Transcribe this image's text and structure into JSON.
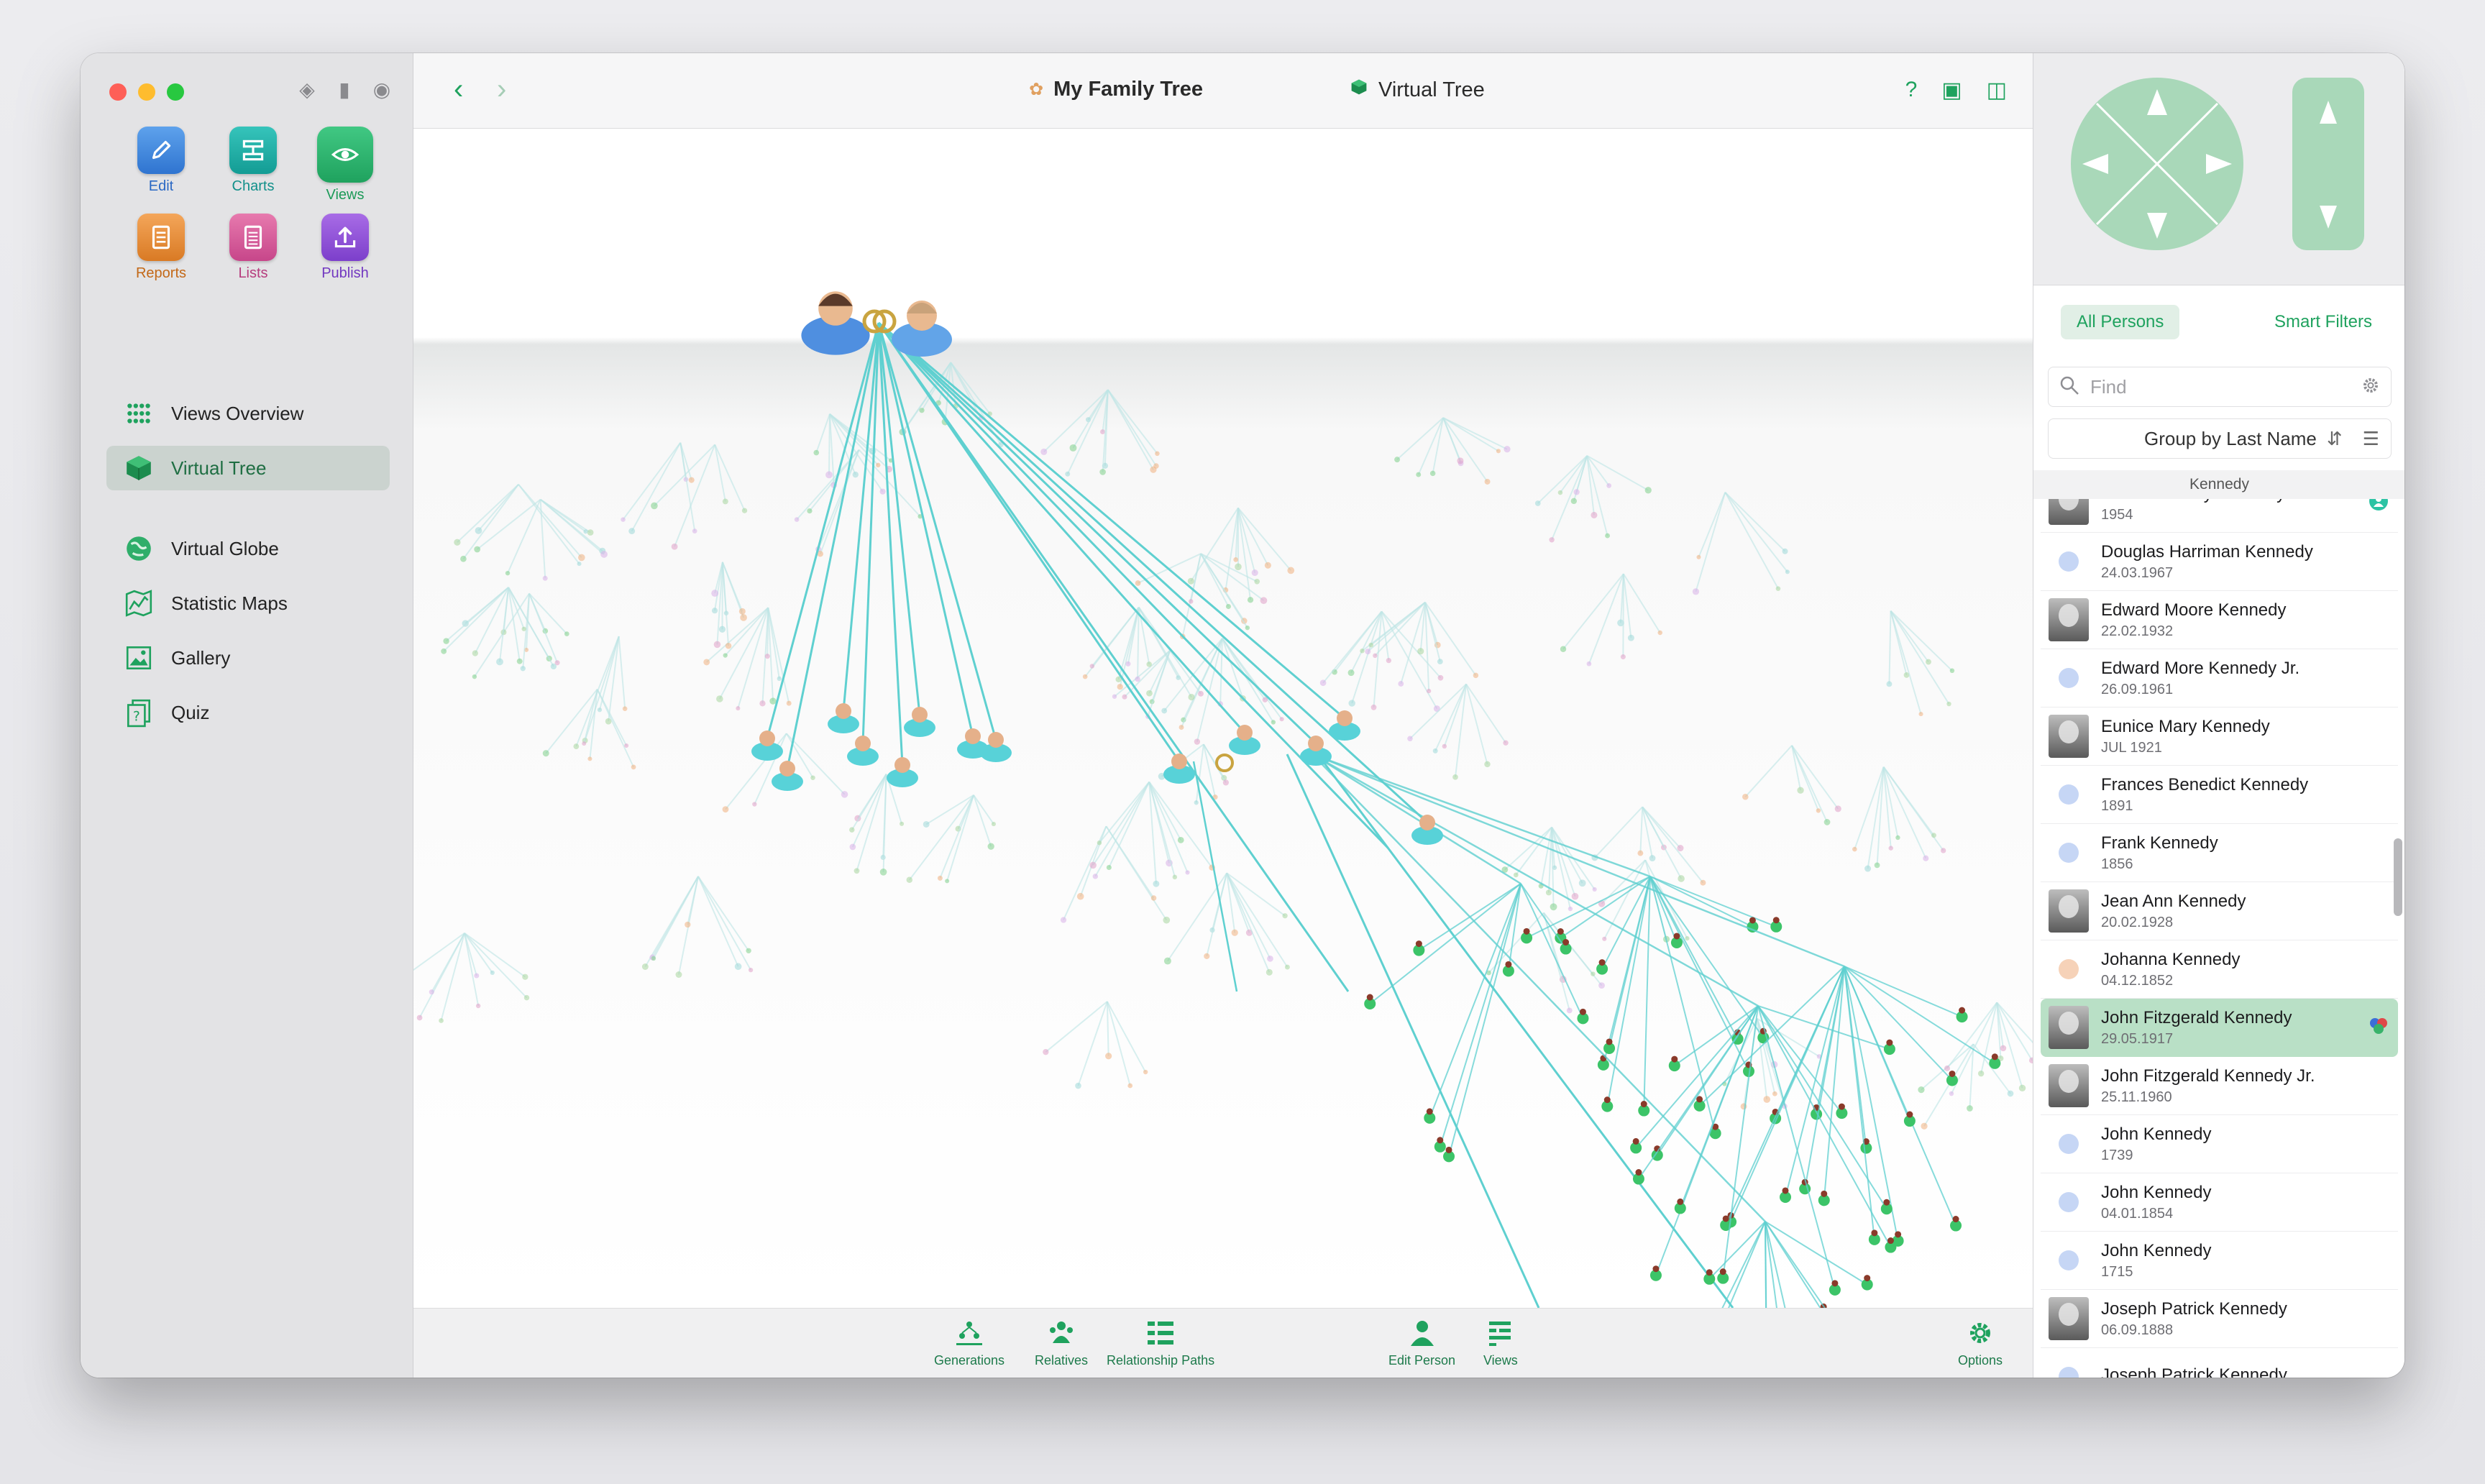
{
  "window": {
    "title": "My Family Tree",
    "subtitle": "Virtual Tree"
  },
  "sidebar": {
    "modes": [
      {
        "label": "Edit",
        "icon": "pencil-icon",
        "color": "#2f74d0"
      },
      {
        "label": "Charts",
        "icon": "chart-icon",
        "color": "#139c94"
      },
      {
        "label": "Views",
        "icon": "eye-icon",
        "color": "#1fa25e"
      },
      {
        "label": "Reports",
        "icon": "report-icon",
        "color": "#d97a24"
      },
      {
        "label": "Lists",
        "icon": "list-icon",
        "color": "#c7468a"
      },
      {
        "label": "Publish",
        "icon": "upload-icon",
        "color": "#7c3fcb"
      }
    ],
    "items": [
      {
        "label": "Views Overview",
        "icon": "grid-icon"
      },
      {
        "label": "Virtual Tree",
        "icon": "cube-icon",
        "selected": true
      },
      {
        "label": "Virtual Globe",
        "icon": "globe-icon"
      },
      {
        "label": "Statistic Maps",
        "icon": "map-icon"
      },
      {
        "label": "Gallery",
        "icon": "gallery-icon"
      },
      {
        "label": "Quiz",
        "icon": "quiz-icon"
      }
    ]
  },
  "bottombar": {
    "items": [
      {
        "label": "Generations",
        "icon": "generations-icon"
      },
      {
        "label": "Relatives",
        "icon": "relatives-icon"
      },
      {
        "label": "Relationship Paths",
        "icon": "relationship-paths-icon"
      },
      {
        "label": "Edit Person",
        "icon": "person-icon"
      },
      {
        "label": "Views",
        "icon": "views-icon"
      },
      {
        "label": "Options",
        "icon": "gear-icon"
      }
    ]
  },
  "rightpanel": {
    "tabs": [
      "All Persons",
      "Smart Filters"
    ],
    "active_tab": "All Persons",
    "search": {
      "placeholder": "Find",
      "value": ""
    },
    "group_by": "Group by Last Name",
    "section": "Kennedy",
    "persons": [
      {
        "name": "David Anthony Kennedy",
        "date": "1954",
        "photo": true,
        "badge": "relatives-badge"
      },
      {
        "name": "Douglas Harriman Kennedy",
        "date": "24.03.1967",
        "dot": "#c6d6f5"
      },
      {
        "name": "Edward Moore Kennedy",
        "date": "22.02.1932",
        "photo": true
      },
      {
        "name": "Edward More Kennedy Jr.",
        "date": "26.09.1961",
        "dot": "#c6d6f5"
      },
      {
        "name": "Eunice Mary Kennedy",
        "date": "JUL 1921",
        "photo": true
      },
      {
        "name": "Frances Benedict Kennedy",
        "date": "1891",
        "dot": "#c6d6f5"
      },
      {
        "name": "Frank Kennedy",
        "date": "1856",
        "dot": "#c6d6f5"
      },
      {
        "name": "Jean Ann Kennedy",
        "date": "20.02.1928",
        "photo": true
      },
      {
        "name": "Johanna Kennedy",
        "date": "04.12.1852",
        "dot": "#f6d2b8"
      },
      {
        "name": "John Fitzgerald Kennedy",
        "date": "29.05.1917",
        "photo": true,
        "selected": true,
        "badge": "flag-badge"
      },
      {
        "name": "John Fitzgerald Kennedy Jr.",
        "date": "25.11.1960",
        "photo": true
      },
      {
        "name": "John Kennedy",
        "date": "1739",
        "dot": "#c6d6f5"
      },
      {
        "name": "John Kennedy",
        "date": "04.01.1854",
        "dot": "#c6d6f5"
      },
      {
        "name": "John Kennedy",
        "date": "1715",
        "dot": "#c6d6f5"
      },
      {
        "name": "Joseph Patrick Kennedy",
        "date": "06.09.1888",
        "photo": true
      },
      {
        "name": "Joseph Patrick Kennedy",
        "date": "",
        "dot": "#c6d6f5"
      }
    ]
  },
  "colors": {
    "accent": "#1fa25e",
    "tree_line": "#5fd0d0",
    "selection": "#b9e0c6"
  }
}
